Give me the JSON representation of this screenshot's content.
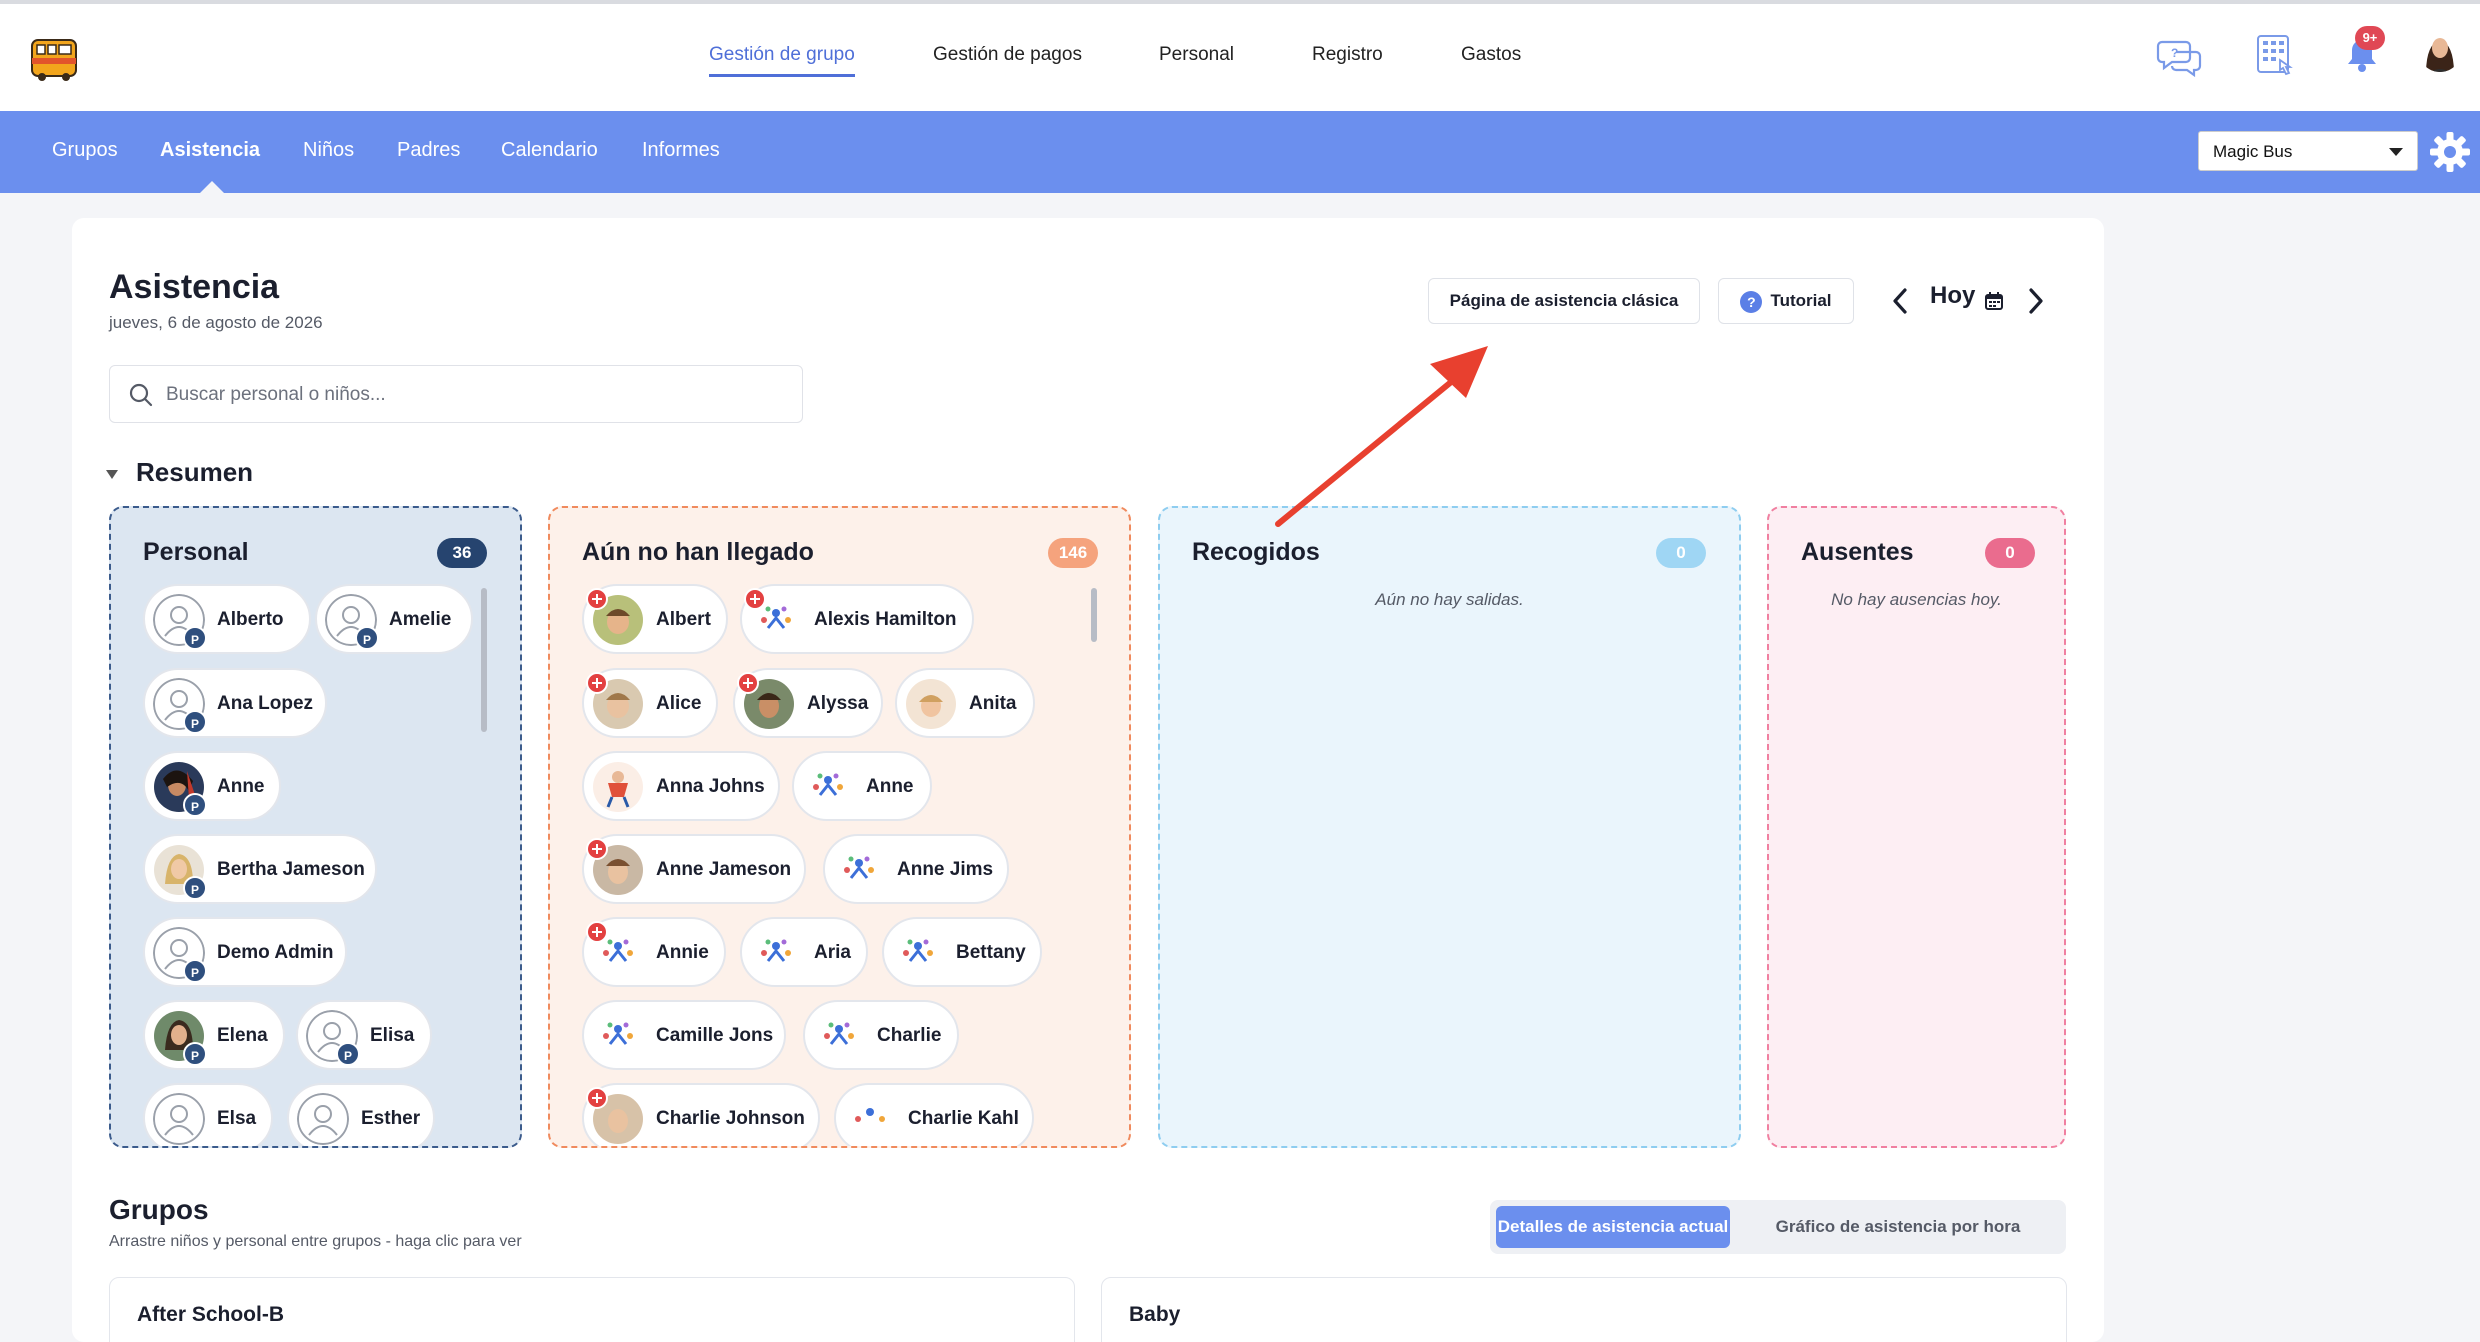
{
  "topnav": {
    "items": [
      "Gestión de grupo",
      "Gestión de pagos",
      "Personal",
      "Registro",
      "Gastos"
    ],
    "notification_badge": "9+"
  },
  "subnav": {
    "items": [
      "Grupos",
      "Asistencia",
      "Niños",
      "Padres",
      "Calendario",
      "Informes"
    ],
    "company": "Magic Bus"
  },
  "page": {
    "title": "Asistencia",
    "date": "jueves, 6 de agosto de 2026",
    "classic_button": "Página de asistencia clásica",
    "tutorial_button": "Tutorial",
    "today": "Hoy",
    "search_placeholder": "Buscar personal o niños..."
  },
  "summary": {
    "title": "Resumen",
    "staff": {
      "title": "Personal",
      "count": "36",
      "badge_letter": "P",
      "people": [
        "Alberto",
        "Amelie",
        "Ana Lopez",
        "Anne",
        "Bertha Jameson",
        "Demo Admin",
        "Elena",
        "Elisa",
        "Elsa",
        "Esther"
      ]
    },
    "not_arrived": {
      "title": "Aún no han llegado",
      "count": "146",
      "children": [
        "Albert",
        "Alexis Hamilton",
        "Alice",
        "Alyssa",
        "Anita",
        "Anna Johns",
        "Anne",
        "Anne Jameson",
        "Anne Jims",
        "Annie",
        "Aria",
        "Bettany",
        "Camille Jons",
        "Charlie",
        "Charlie Johnson",
        "Charlie Kahl"
      ]
    },
    "picked_up": {
      "title": "Recogidos",
      "count": "0",
      "empty": "Aún no hay salidas."
    },
    "absent": {
      "title": "Ausentes",
      "count": "0",
      "empty": "No hay ausencias hoy."
    }
  },
  "groups": {
    "title": "Grupos",
    "subtitle": "Arrastre niños y personal entre grupos - haga clic para ver",
    "toggle_active": "Detalles de asistencia actual",
    "toggle_inactive": "Gráfico de asistencia por hora",
    "cards": [
      "After School-B",
      "Baby"
    ]
  },
  "colors": {
    "brand_blue": "#6b8fee",
    "staff_border": "#3b5b8c",
    "not_arrived_border": "#f08a5d",
    "picked_border": "#8ecdf0",
    "absent_border": "#f07fa0",
    "annotation_arrow": "#e8402f"
  }
}
